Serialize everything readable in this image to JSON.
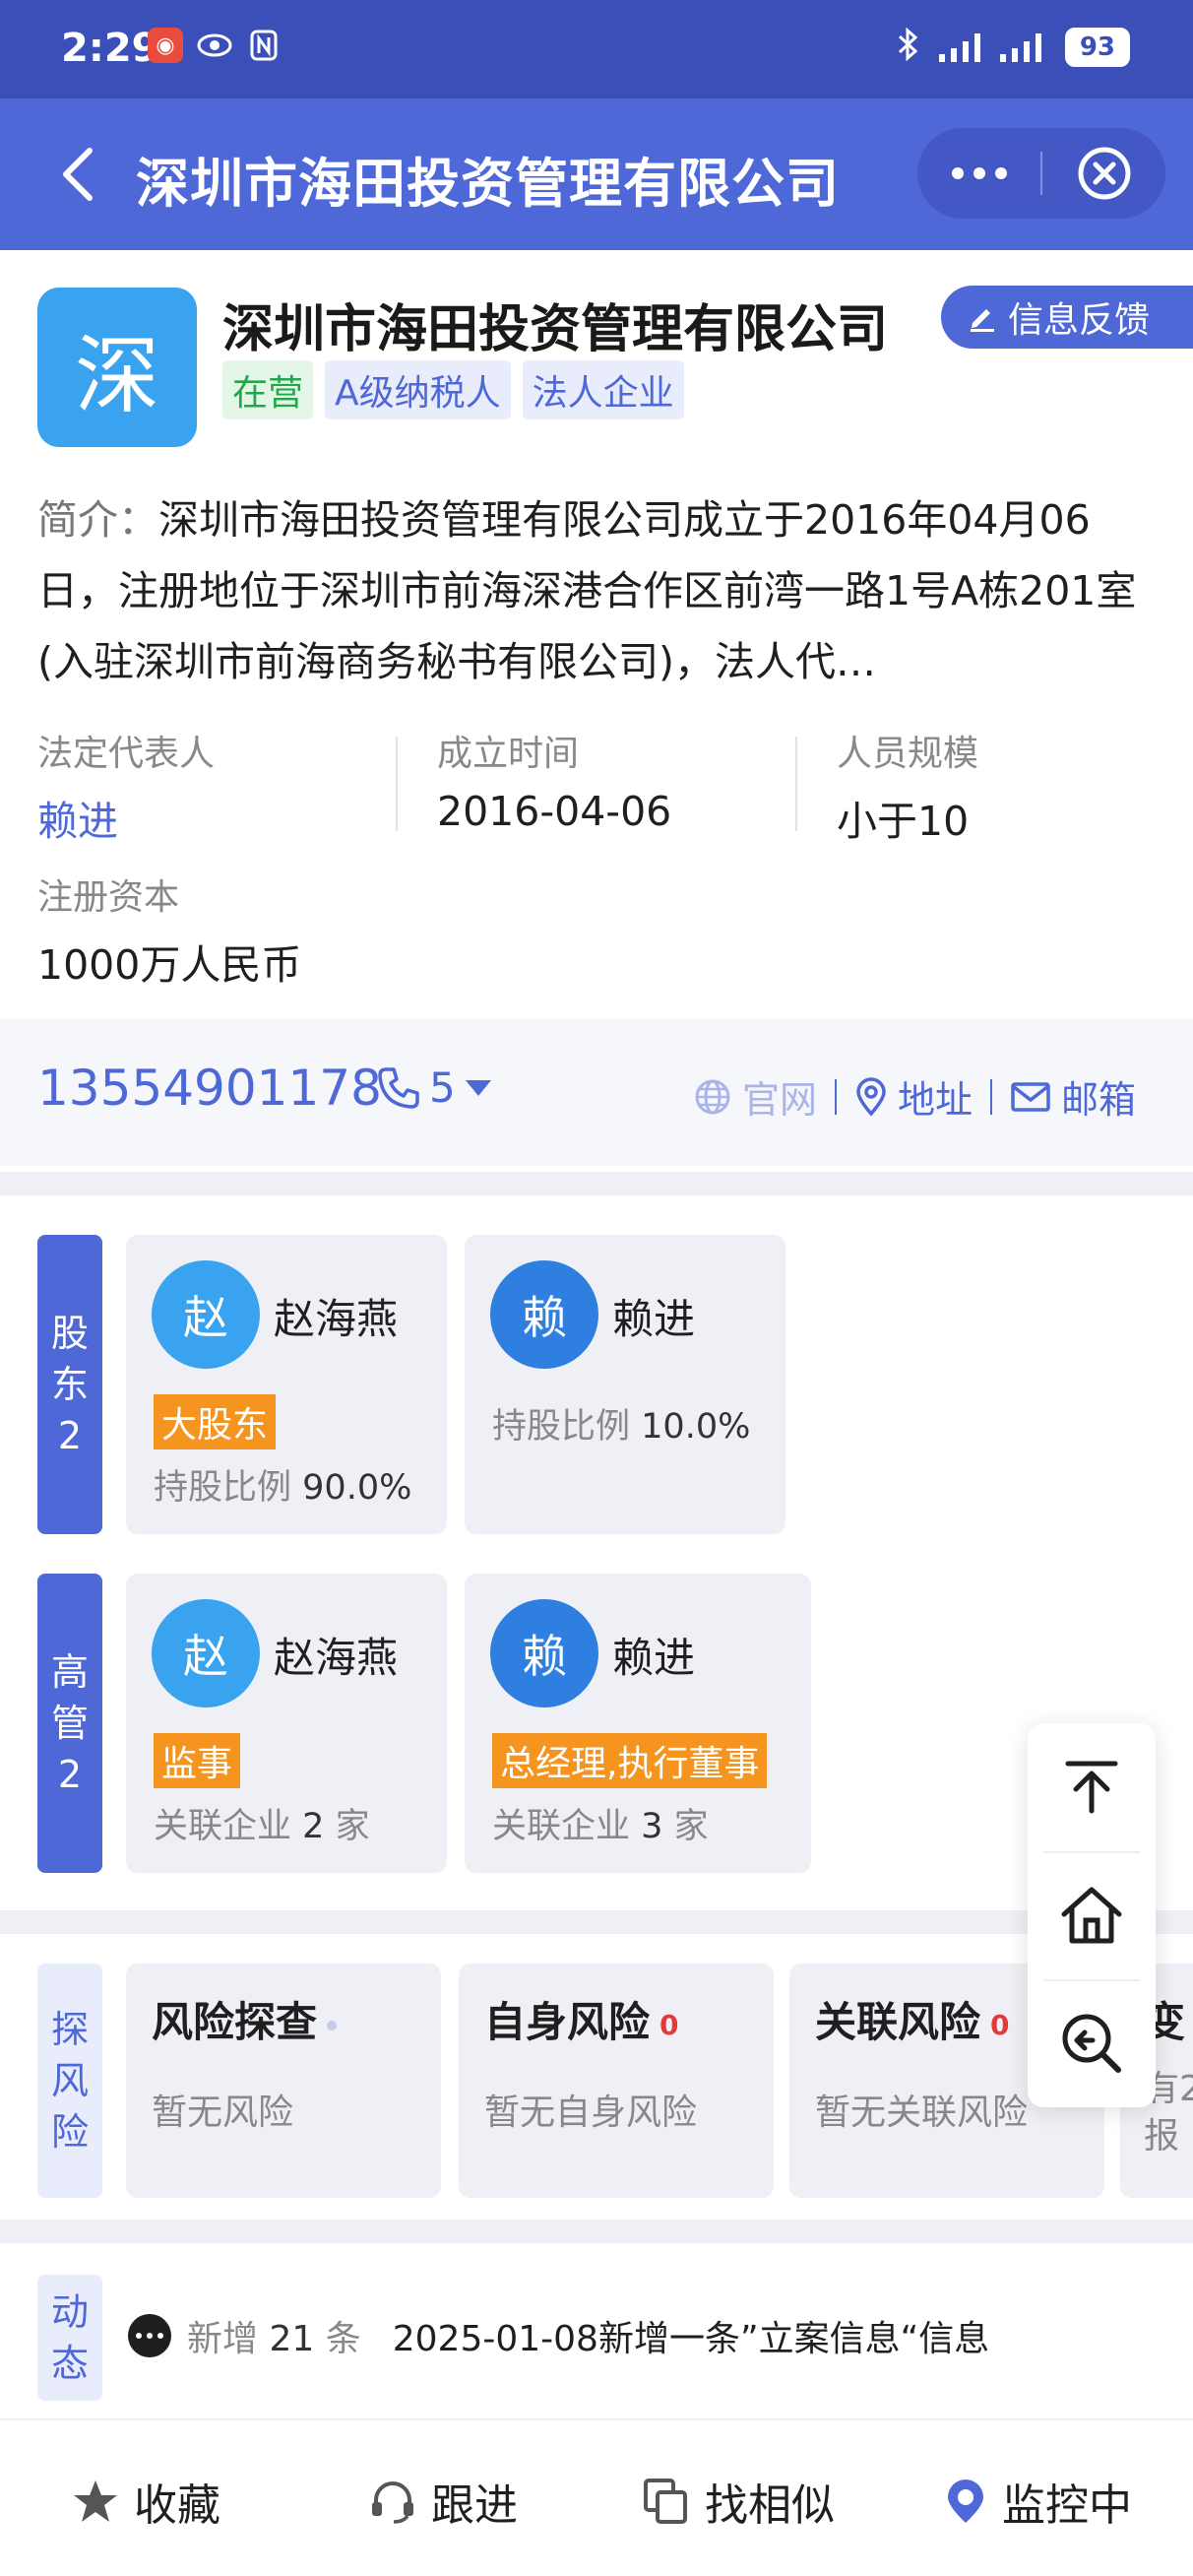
{
  "status_bar": {
    "time": "2:29",
    "network": "4G 4G",
    "battery": "93"
  },
  "nav": {
    "title": "深圳市海田投资管理有限公司"
  },
  "company": {
    "logo_char": "深",
    "name": "深圳市海田投资管理有限公司",
    "feedback_label": "信息反馈",
    "tags": [
      "在营",
      "A级纳税人",
      "法人企业"
    ]
  },
  "intro": {
    "label": "简介：",
    "text": "深圳市海田投资管理有限公司成立于2016年04月06日，注册地位于深圳市前海深港合作区前湾一路1号A栋201室(入驻深圳市前海商务秘书有限公司)，法人代…"
  },
  "info": {
    "legal_rep_label": "法定代表人",
    "legal_rep": "赖进",
    "founded_label": "成立时间",
    "founded": "2016-04-06",
    "staff_label": "人员规模",
    "staff": "小于10",
    "capital_label": "注册资本",
    "capital": "1000万人民币"
  },
  "contact": {
    "phone": "13554901178",
    "phone_count": "5",
    "website": "官网",
    "address": "地址",
    "email": "邮箱"
  },
  "shareholders": {
    "label_chars": [
      "股",
      "东",
      "2"
    ],
    "items": [
      {
        "avatar": "赵",
        "name": "赵海燕",
        "badge": "大股东",
        "meta_label": "持股比例",
        "meta_value": "90.0%"
      },
      {
        "avatar": "赖",
        "name": "赖进",
        "meta_label": "持股比例",
        "meta_value": "10.0%"
      }
    ]
  },
  "executives": {
    "label_chars": [
      "高",
      "管",
      "2"
    ],
    "items": [
      {
        "avatar": "赵",
        "name": "赵海燕",
        "badge": "监事",
        "meta_label": "关联企业",
        "meta_value": "2",
        "meta_unit": "家"
      },
      {
        "avatar": "赖",
        "name": "赖进",
        "badge": "总经理,执行董事",
        "meta_label": "关联企业",
        "meta_value": "3",
        "meta_unit": "家"
      }
    ]
  },
  "risk": {
    "label_chars": [
      "探",
      "风",
      "险"
    ],
    "items": [
      {
        "title": "风险探查",
        "sub": "暂无风险"
      },
      {
        "title": "自身风险",
        "count": "0",
        "sub": "暂无自身风险"
      },
      {
        "title": "关联风险",
        "count": "0",
        "sub": "暂无关联风险"
      },
      {
        "title": "变",
        "sub": "有2",
        "sub2": "报"
      }
    ]
  },
  "dynamic": {
    "label_chars": [
      "动",
      "态"
    ],
    "prefix": "新增",
    "count": "21",
    "unit": "条",
    "text": "2025-01-08新增一条”立案信息“信息"
  },
  "bottom": {
    "favorite": "收藏",
    "follow": "跟进",
    "similar": "找相似",
    "monitor": "监控中"
  },
  "colors": {
    "primary": "#4e68d8",
    "status_bar": "#3b4fb8",
    "badge_orange": "#f5941e",
    "tag_green": "#22a84a",
    "risk_red": "#e23a3a"
  }
}
